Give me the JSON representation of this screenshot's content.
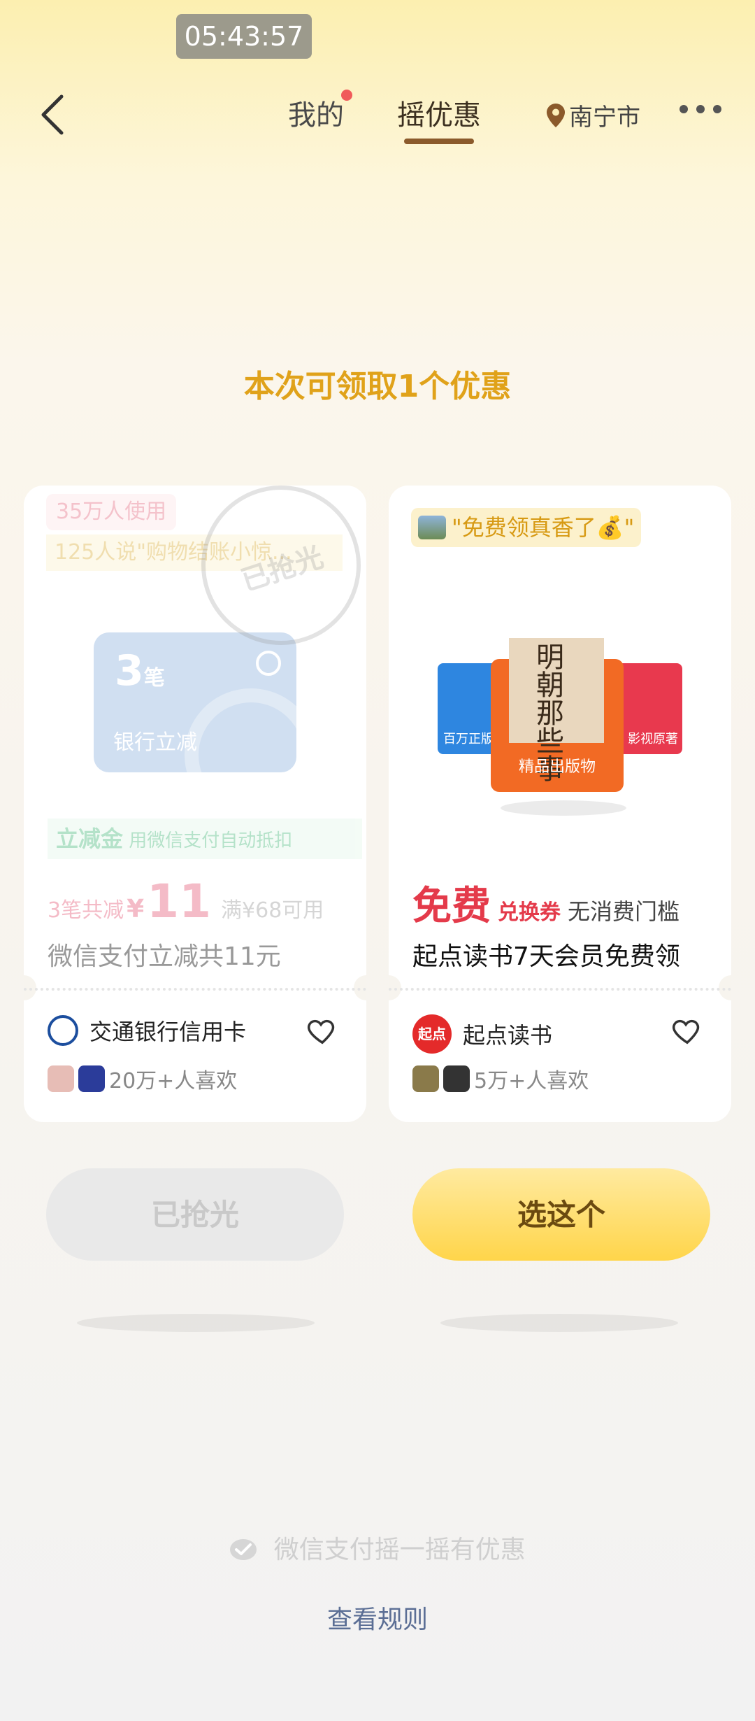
{
  "status": {
    "time": "05:43:57"
  },
  "nav": {
    "tabs": [
      {
        "label": "我的",
        "has_dot": true
      },
      {
        "label": "摇优惠",
        "active": true
      }
    ],
    "location": "南宁市"
  },
  "headline": "本次可领取1个优惠",
  "cards": [
    {
      "state": "sold_out",
      "tag": "35万人使用",
      "comment": "125人说\"购物结账小惊...",
      "stamp": "已抢光",
      "bank_card": {
        "count": "3",
        "unit": "笔",
        "label": "银行立减"
      },
      "benefit": {
        "title": "立减金",
        "desc": "用微信支付自动抵扣"
      },
      "price": {
        "prefix": "3笔共减",
        "currency": "¥",
        "amount": "11",
        "condition": "满¥68可用"
      },
      "description": "微信支付立减共11元",
      "brand": "交通银行信用卡",
      "likes": "20万+人喜欢"
    },
    {
      "state": "available",
      "quote": "\"免费领真香了💰\"",
      "books": {
        "center_title": "明朝那些事",
        "center_label": "精品出版物",
        "left_label": "百万正版",
        "right_label": "影视原著"
      },
      "price": {
        "big": "免费",
        "type": "兑换券",
        "condition": "无消费门槛"
      },
      "description": "起点读书7天会员免费领",
      "brand": "起点读书",
      "brand_logo_text": "起点",
      "likes": "5万+人喜欢"
    }
  ],
  "buttons": {
    "sold_out": "已抢光",
    "choose": "选这个"
  },
  "footer": {
    "brand": "微信支付摇一摇有优惠",
    "rules": "查看规则"
  },
  "colors": {
    "accent_yellow": "#E0A21A",
    "brand_red": "#E43A4A",
    "link_blue": "#5B6E95"
  }
}
